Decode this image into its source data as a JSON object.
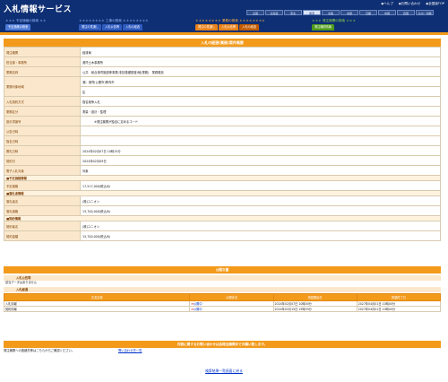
{
  "header": {
    "logo": "入札情報サービス",
    "links": [
      "◆ヘルプ",
      "◆お問い合わせ",
      "◆全国版TOP"
    ],
    "regions": [
      "全国",
      "北海道",
      "東北",
      "関東",
      "北陸",
      "中部",
      "近畿",
      "中国",
      "四国",
      "九州・沖縄"
    ],
    "active_region": "関東"
  },
  "nav": {
    "groups": [
      {
        "title": "＊＊＊ 予定価格の検索 ＊＊",
        "title_color": "#9fb8ff",
        "tabs": [
          "予定価格の検索"
        ],
        "tab_colors": [
          "#4d79d6"
        ]
      },
      {
        "title": "＊＊＊＊＊＊＊＊ 工事の検索 ＊＊＊＊＊＊＊＊",
        "title_color": "#9fb8ff",
        "tabs": [
          "発注の見通し",
          "入札公告等",
          "入札の経過"
        ],
        "tab_colors": [
          "#2f5bbf",
          "#2f5bbf",
          "#2f5bbf"
        ]
      },
      {
        "title": "＊＊＊＊＊＊＊＊ 業務の検索 ＊＊＊＊＊＊＊＊",
        "title_color": "#ffb347",
        "tabs": [
          "発注の見通し",
          "入札公告等",
          "入札の経過"
        ],
        "tab_colors": [
          "#e8821a",
          "#e8821a",
          "#c25a00"
        ]
      },
      {
        "title": "＊＊＊ 発注機関の検索 ＊＊＊",
        "title_color": "#8fd14f",
        "tabs": [
          "発注機関情報"
        ],
        "tab_colors": [
          "#4e9a1c"
        ]
      }
    ]
  },
  "detail": {
    "title": "入札の経過(業務)案件概要",
    "rows": [
      {
        "type": "row",
        "label": "発注機関",
        "value": "経済局"
      },
      {
        "type": "row",
        "label": "担当部・事務所",
        "value": "港湾土木事務所"
      },
      {
        "type": "row",
        "label": "業務名称",
        "value": "公共　総合港湾施設等事業(非技基礎調査)他(業務)　業務委託"
      },
      {
        "type": "row2",
        "label": "業務対象地域",
        "value": "港）港湾(公開市)等内市",
        "value2": "区"
      },
      {
        "type": "row",
        "label": "入札契約方式",
        "value": "指名競争入札"
      },
      {
        "type": "row",
        "label": "業務区分",
        "value": "測量・設計・監理"
      },
      {
        "type": "row",
        "label": "設計書番号",
        "value": "　　　　※発注機関が独自に定めるコード"
      },
      {
        "type": "row",
        "label": "公告日時",
        "value": ""
      },
      {
        "type": "row",
        "label": "指名日時",
        "value": ""
      },
      {
        "type": "row",
        "label": "開札日時",
        "value": "2024年02月07日 10時15分"
      },
      {
        "type": "row",
        "label": "契約日",
        "value": "2024年02月09日"
      },
      {
        "type": "row",
        "label": "電子入札対象",
        "value": "対象"
      },
      {
        "type": "section",
        "label": "■予定価格情報"
      },
      {
        "type": "row",
        "label": "予定価格",
        "value": "17,517,000(税込み)"
      },
      {
        "type": "section",
        "label": "■落札者情報"
      },
      {
        "type": "row",
        "label": "落札者名",
        "value": "(株)ユニオン"
      },
      {
        "type": "row",
        "label": "落札価格",
        "value": "15,700,000(税込み)"
      },
      {
        "type": "section",
        "label": "■契約情報"
      },
      {
        "type": "row",
        "label": "契約者名",
        "value": "(株)ユニオン"
      },
      {
        "type": "row",
        "label": "契約金額",
        "value": "15,700,000(税込み)"
      }
    ]
  },
  "docs": {
    "bar_title": "公開文書",
    "notice_head": "入札公告等",
    "notice_text": "該当データはありません",
    "result_head": "入札経過",
    "columns": [
      "文書名称",
      "公開状況",
      "掲載開始日",
      "掲載終了日"
    ],
    "files": [
      {
        "name": "入札情報",
        "link": "公開中",
        "start": "2024年02月07日 10時00分",
        "end": "2027年04月01日 10時00分"
      },
      {
        "name": "契約情報",
        "link": "公開中",
        "start": "2024年02月15日 15時53分",
        "end": "2027年04月01日 10時00分"
      }
    ]
  },
  "contact": {
    "bar_title": "内容に関するお問い合わせは各発注機関までお願い致します。",
    "text": "発注機関への連絡先等はこちらからご確認ください。",
    "link": "問い合わせ先一覧"
  },
  "back_link": "検索結果一覧画面に戻る",
  "colors": {
    "navy": "#0e2f73",
    "orange": "#f39a1b",
    "label_bg": "#fbe8cc"
  }
}
